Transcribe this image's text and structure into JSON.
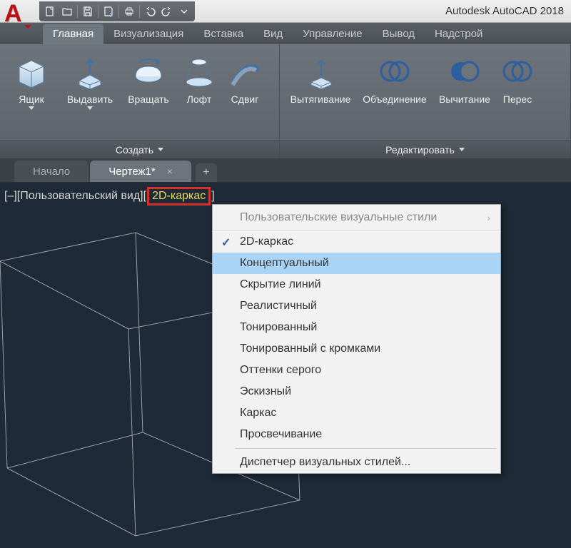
{
  "app": {
    "title": "Autodesk AutoCAD 2018"
  },
  "ribbon_tabs": [
    {
      "label": "Главная",
      "active": true
    },
    {
      "label": "Визуализация"
    },
    {
      "label": "Вставка"
    },
    {
      "label": "Вид"
    },
    {
      "label": "Управление"
    },
    {
      "label": "Вывод"
    },
    {
      "label": "Надстрой"
    }
  ],
  "ribbon": {
    "panel_create": {
      "title": "Создать",
      "tools": [
        {
          "label": "Ящик",
          "icon": "box-icon",
          "dropdown": true
        },
        {
          "label": "Выдавить",
          "icon": "extrude-icon",
          "dropdown": true
        },
        {
          "label": "Вращать",
          "icon": "revolve-icon"
        },
        {
          "label": "Лофт",
          "icon": "loft-icon"
        },
        {
          "label": "Сдвиг",
          "icon": "sweep-icon"
        }
      ]
    },
    "panel_edit": {
      "title": "Редактировать",
      "tools": [
        {
          "label": "Вытягивание",
          "icon": "presspull-icon"
        },
        {
          "label": "Объединение",
          "icon": "union-icon"
        },
        {
          "label": "Вычитание",
          "icon": "subtract-icon"
        },
        {
          "label": "Перес",
          "icon": "intersect-icon"
        }
      ]
    }
  },
  "doc_tabs": {
    "start": "Начало",
    "drawing": "Чертеж1*",
    "close": "×",
    "plus": "+"
  },
  "viewport": {
    "toggle": "[–]",
    "view_label": "[Пользовательский вид]",
    "style_label_open": "[",
    "style_label": "2D-каркас",
    "style_label_close": "]"
  },
  "context_menu": {
    "header": "Пользовательские визуальные стили",
    "items": [
      {
        "label": "2D-каркас",
        "checked": true
      },
      {
        "label": "Концептуальный",
        "hover": true
      },
      {
        "label": "Скрытие линий"
      },
      {
        "label": "Реалистичный"
      },
      {
        "label": "Тонированный"
      },
      {
        "label": "Тонированный с кромками"
      },
      {
        "label": "Оттенки серого"
      },
      {
        "label": "Эскизный"
      },
      {
        "label": "Каркас"
      },
      {
        "label": "Просвечивание"
      }
    ],
    "manager": "Диспетчер визуальных стилей..."
  }
}
